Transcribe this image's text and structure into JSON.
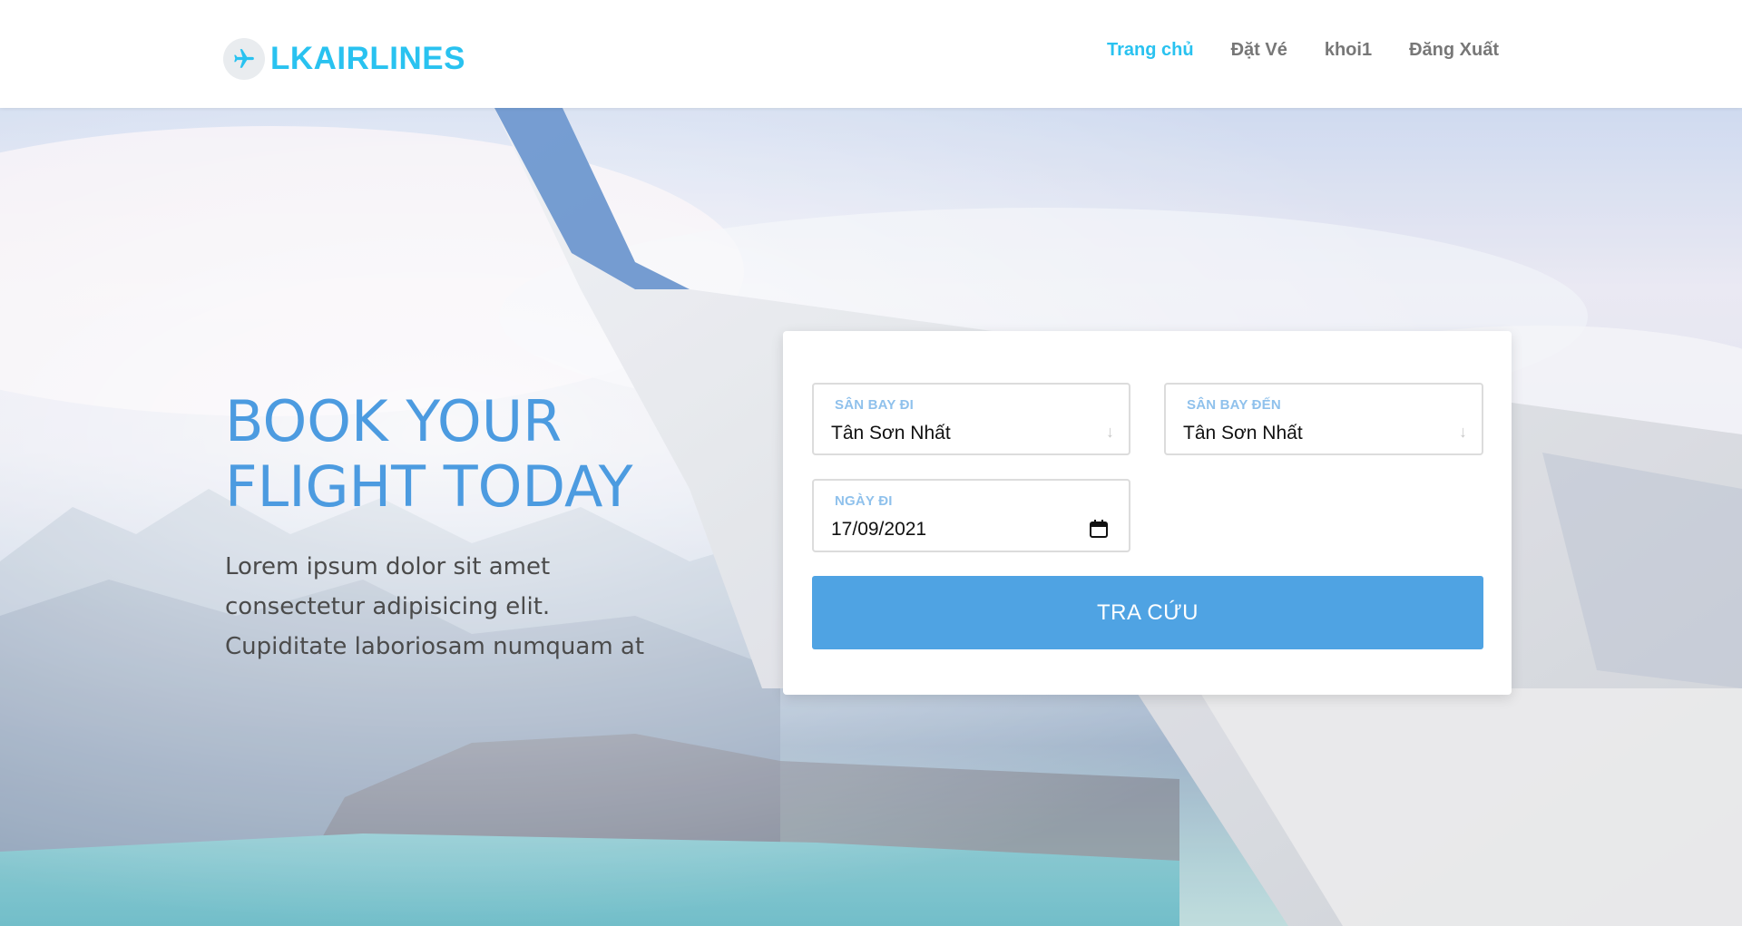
{
  "brand": {
    "name": "LKAIRLINES",
    "logo_icon": "airplane-icon",
    "color": "#29c2f0"
  },
  "nav": {
    "items": [
      {
        "label": "Trang chủ",
        "active": true
      },
      {
        "label": "Đặt Vé",
        "active": false
      },
      {
        "label": "khoi1",
        "active": false
      },
      {
        "label": "Đăng Xuất",
        "active": false
      }
    ]
  },
  "hero": {
    "title_line1": "BOOK YOUR",
    "title_line2": "FLIGHT TODAY",
    "desc_line1": "Lorem ipsum dolor sit amet",
    "desc_line2": "consectetur adipisicing elit.",
    "desc_line3": "Cupiditate laboriosam numquam at",
    "title_color": "#4c9be0"
  },
  "booking": {
    "from": {
      "label": "SÂN BAY ĐI",
      "value": "Tân Sơn Nhất",
      "icon": "arrow-down-icon"
    },
    "to": {
      "label": "SÂN BAY ĐẾN",
      "value": "Tân Sơn Nhất",
      "icon": "arrow-down-icon"
    },
    "date": {
      "label": "NGÀY ĐI",
      "value": "17/09/2021",
      "icon": "calendar-icon"
    },
    "search_label": "TRA CỨU",
    "button_color": "#4fa3e3"
  }
}
